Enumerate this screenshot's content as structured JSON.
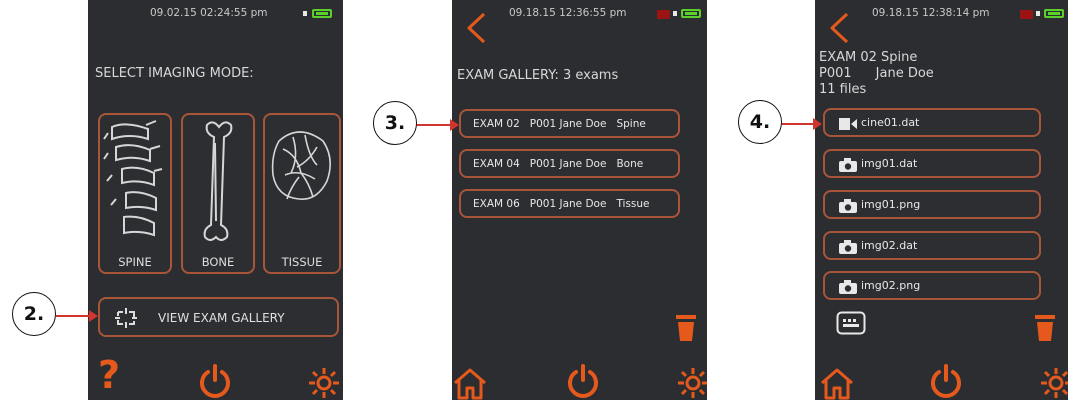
{
  "screen1": {
    "timestamp": "09.02.15  02:24:55 pm",
    "heading": "SELECT IMAGING MODE:",
    "modes": [
      {
        "label": "SPINE"
      },
      {
        "label": "BONE"
      },
      {
        "label": "TISSUE"
      }
    ],
    "gallery_button": "VIEW EXAM GALLERY",
    "help_glyph": "?"
  },
  "screen2": {
    "timestamp": "09.18.15  12:36:55 pm",
    "heading": "EXAM GALLERY: 3 exams",
    "exams": [
      {
        "label": "EXAM 02   P001 Jane Doe   Spine"
      },
      {
        "label": "EXAM 04   P001 Jane Doe   Bone"
      },
      {
        "label": "EXAM 06   P001 Jane Doe   Tissue"
      }
    ]
  },
  "screen3": {
    "timestamp": "09.18.15  12:38:14 pm",
    "exam_title": "EXAM 02 Spine",
    "patient_id": "P001",
    "patient_name": "Jane Doe",
    "file_count": "11 files",
    "files": [
      {
        "name": "cine01.dat",
        "icon": "video-icon"
      },
      {
        "name": "img01.dat",
        "icon": "camera-icon"
      },
      {
        "name": "img01.png",
        "icon": "camera-icon"
      },
      {
        "name": "img02.dat",
        "icon": "camera-icon"
      },
      {
        "name": "img02.png",
        "icon": "camera-icon"
      }
    ]
  },
  "callouts": {
    "c2": "2.",
    "c3": "3.",
    "c4": "4."
  },
  "colors": {
    "accent": "#e55a1c",
    "border": "#a8553a",
    "screen_bg": "#2b2d31",
    "callout_arrow": "#d2352d",
    "battery": "#5bd22a"
  }
}
